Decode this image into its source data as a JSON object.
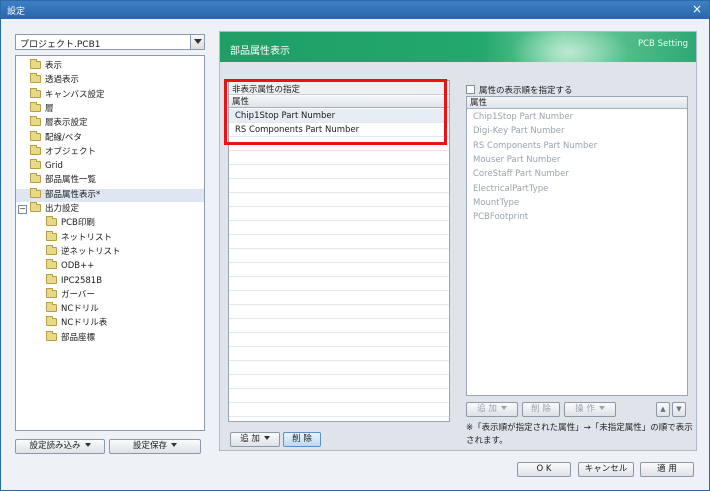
{
  "window": {
    "title": "設定",
    "close_glyph": "×"
  },
  "left": {
    "combo_value": "プロジェクト.PCB1",
    "tree": [
      {
        "label": "表示",
        "indent": 0
      },
      {
        "label": "透過表示",
        "indent": 0
      },
      {
        "label": "キャンバス設定",
        "indent": 0
      },
      {
        "label": "層",
        "indent": 0
      },
      {
        "label": "層表示設定",
        "indent": 0
      },
      {
        "label": "配線/ベタ",
        "indent": 0
      },
      {
        "label": "オブジェクト",
        "indent": 0
      },
      {
        "label": "Grid",
        "indent": 0
      },
      {
        "label": "部品属性一覧",
        "indent": 0
      },
      {
        "label": "部品属性表示*",
        "indent": 0
      },
      {
        "label": "出力設定",
        "indent": 0
      },
      {
        "label": "PCB印刷",
        "indent": 1
      },
      {
        "label": "ネットリスト",
        "indent": 1
      },
      {
        "label": "逆ネットリスト",
        "indent": 1
      },
      {
        "label": "ODB++",
        "indent": 1
      },
      {
        "label": "IPC2581B",
        "indent": 1
      },
      {
        "label": "ガーバー",
        "indent": 1
      },
      {
        "label": "NCドリル",
        "indent": 1
      },
      {
        "label": "NCドリル表",
        "indent": 1
      },
      {
        "label": "部品座標",
        "indent": 1
      }
    ],
    "expander_glyph": "−",
    "load_button": "設定読み込み",
    "save_button": "設定保存"
  },
  "panel": {
    "banner_title": "部品属性表示",
    "banner_right": "PCB Setting",
    "hidden_group": {
      "caption": "非表示属性の指定",
      "column": "属性",
      "rows": [
        "Chip1Stop Part Number",
        "RS Components Part Number"
      ]
    },
    "add_button": "追 加",
    "delete_button": "削 除",
    "order_group": {
      "checkbox_label": "属性の表示順を指定する",
      "column": "属性",
      "rows": [
        "Chip1Stop Part Number",
        "Digi-Key Part Number",
        "RS Components Part Number",
        "Mouser Part Number",
        "CoreStaff Part Number",
        "ElectricalPartType",
        "MountType",
        "PCBFootprint"
      ]
    },
    "order_add_button": "追 加",
    "order_delete_button": "削 除",
    "order_op_button": "操 作",
    "up_glyph": "▲",
    "down_glyph": "▼",
    "note_line1": "※「表示順が指定された属性」→「未指定属性」の順で表示",
    "note_line2": "されます。"
  },
  "footer": {
    "ok": "O K",
    "cancel": "キャンセル",
    "apply": "適 用"
  },
  "colors": {
    "title_bar": "#2a66ab",
    "banner": "#23a86d",
    "highlight": "#ee1111"
  }
}
